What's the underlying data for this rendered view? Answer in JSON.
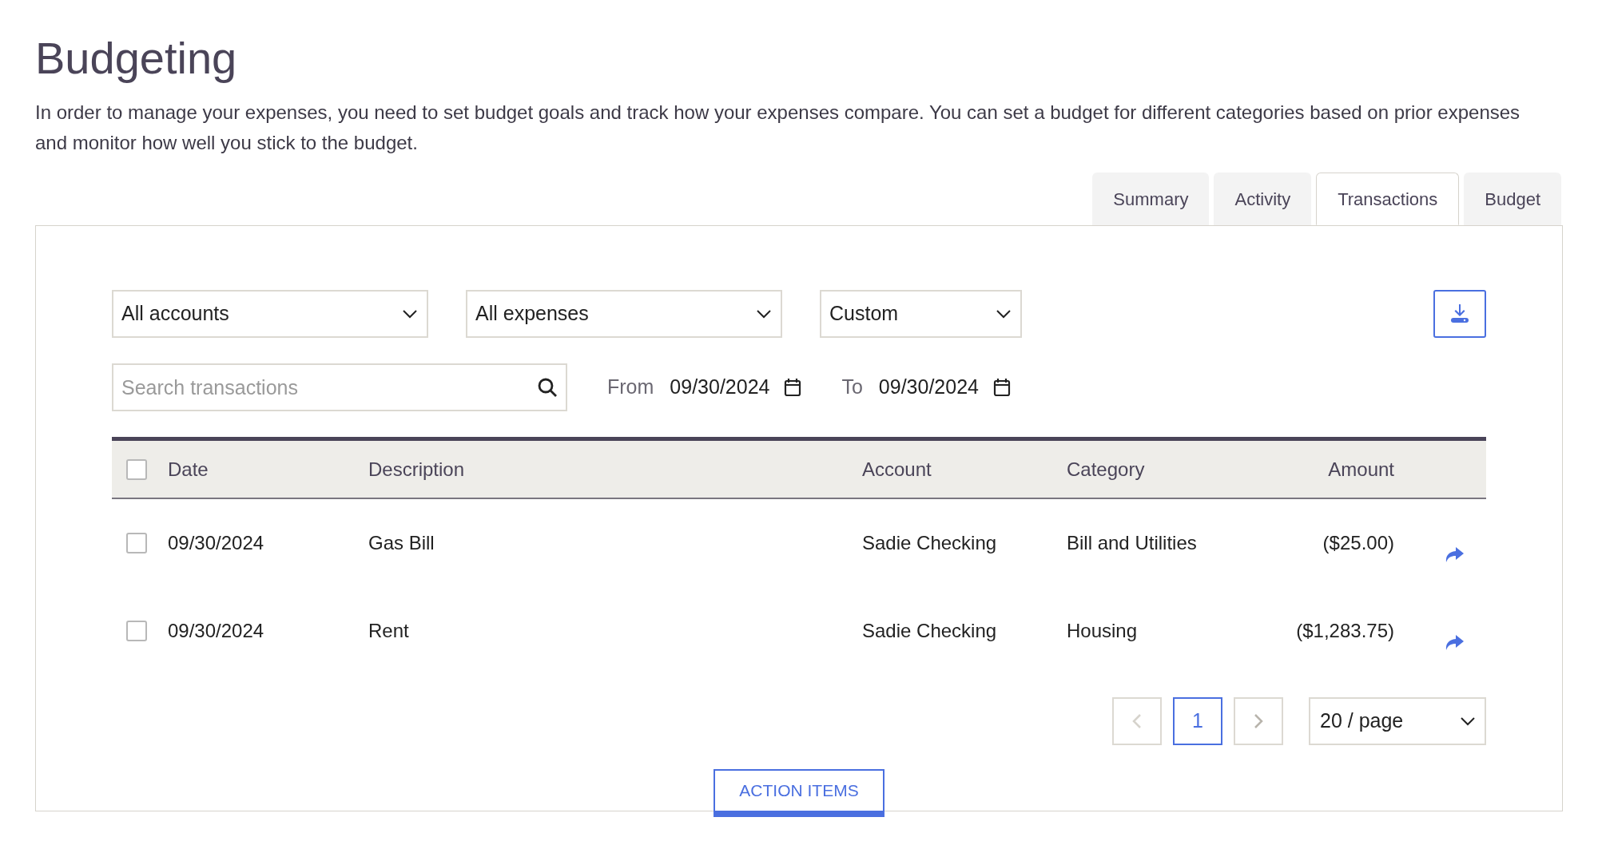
{
  "title": "Budgeting",
  "description": "In order to manage your expenses, you need to set budget goals and track how your expenses compare. You can set a budget for different categories based on prior expenses and monitor how well you stick to the budget.",
  "tabs": [
    {
      "label": "Summary",
      "selected": false
    },
    {
      "label": "Activity",
      "selected": false
    },
    {
      "label": "Transactions",
      "selected": true
    },
    {
      "label": "Budget",
      "selected": false
    }
  ],
  "filters": [
    {
      "value": "All accounts"
    },
    {
      "value": "All expenses"
    },
    {
      "value": "Custom"
    }
  ],
  "search": {
    "placeholder": "Search transactions"
  },
  "date_range": {
    "from_label": "From",
    "from": "09/30/2024",
    "to_label": "To",
    "to": "09/30/2024"
  },
  "table": {
    "columns": [
      "Date",
      "Description",
      "Account",
      "Category",
      "Amount"
    ],
    "all_checked": false,
    "rows": [
      {
        "date": "09/30/2024",
        "description": "Gas Bill",
        "account": "Sadie Checking",
        "category": "Bill and Utilities",
        "amount": "($25.00)",
        "checked": false
      },
      {
        "date": "09/30/2024",
        "description": "Rent",
        "account": "Sadie Checking",
        "category": "Housing",
        "amount": "($1,283.75)",
        "checked": false
      }
    ]
  },
  "pagination": {
    "pages": [
      {
        "label": "1",
        "selected": true
      }
    ],
    "prev_disabled": true,
    "next_disabled": false,
    "page_size": "20 / page"
  },
  "action_button": "ACTION ITEMS"
}
